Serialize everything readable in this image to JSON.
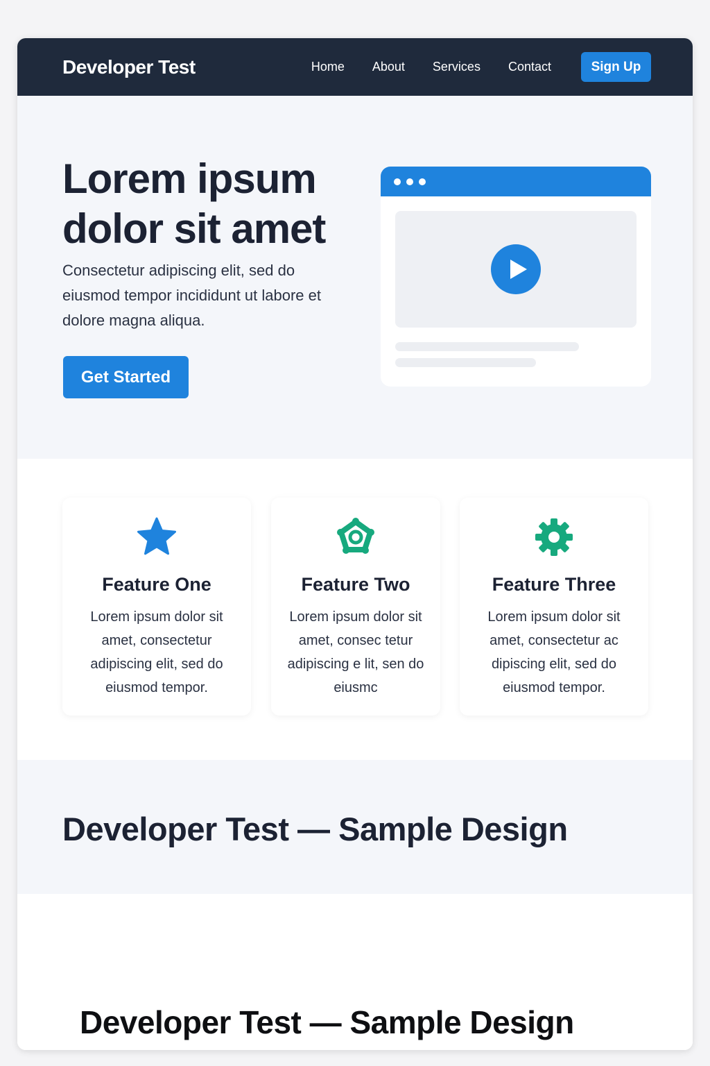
{
  "nav": {
    "brand": "Developer Test",
    "links": [
      "Home",
      "About",
      "Services",
      "Contact"
    ],
    "signup_label": "Sign Up"
  },
  "hero": {
    "title": "Lorem ipsum dolor sit amet",
    "subtitle": "Consectetur adipiscing elit, sed do eiusmod tempor incididunt ut labore et dolore magna aliqua.",
    "cta_label": "Get Started"
  },
  "features": [
    {
      "icon": "star-icon",
      "title": "Feature One",
      "text": "Lorem ipsum dolor sit amet, consectetur adipiscing elit, sed do eiusmod tempor."
    },
    {
      "icon": "pentagon-badge-icon",
      "title": "Feature Two",
      "text": "Lorem ipsum dolor sit amet, consec tetur adipiscing e lit, sen do eiusmc"
    },
    {
      "icon": "gear-icon",
      "title": "Feature Three",
      "text": "Lorem ipsum dolor sit amet, consectetur ac dipiscing elit, sed do eiusmod tempor."
    }
  ],
  "sample": {
    "heading": "Developer Test — Sample Design"
  },
  "bottom": {
    "heading": "Developer Test — Sample Design"
  },
  "colors": {
    "nav_bg": "#1f2a3c",
    "accent_blue": "#1f83dd",
    "accent_green": "#17a97e",
    "hero_bg": "#f4f6fa"
  }
}
